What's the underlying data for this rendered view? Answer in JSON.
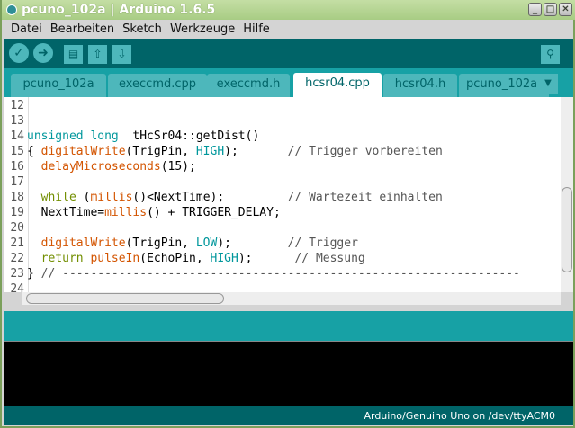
{
  "window": {
    "title": "pcuno_102a | Arduino 1.6.5",
    "buttons": [
      "_",
      "□",
      "✕"
    ]
  },
  "menu": [
    "Datei",
    "Bearbeiten",
    "Sketch",
    "Werkzeuge",
    "Hilfe"
  ],
  "toolbar": {
    "verify": "✓",
    "upload": "➜",
    "new": "▤",
    "open": "⇧",
    "save": "⇩",
    "serial_monitor": "⚲"
  },
  "tabs": [
    {
      "label": "pcuno_102a",
      "active": false
    },
    {
      "label": "execcmd.cpp",
      "active": false
    },
    {
      "label": "execcmd.h",
      "active": false
    },
    {
      "label": "hcsr04.cpp",
      "active": true
    },
    {
      "label": "hcsr04.h",
      "active": false
    },
    {
      "label": "pcuno_102a.h",
      "active": false
    }
  ],
  "tab_menu": "▼",
  "code": [
    {
      "n": "12",
      "seg": []
    },
    {
      "n": "13",
      "seg": []
    },
    {
      "n": "14",
      "seg": [
        [
          "unsigned long",
          "kw"
        ],
        [
          "  tHcSr04::getDist()",
          "pl"
        ]
      ]
    },
    {
      "n": "15",
      "seg": [
        [
          "{ ",
          "pl"
        ],
        [
          "digitalWrite",
          "fn"
        ],
        [
          "(TrigPin, ",
          "pl"
        ],
        [
          "HIGH",
          "kw"
        ],
        [
          ");       ",
          "pl"
        ],
        [
          "// Trigger vorbereiten",
          "cm"
        ]
      ]
    },
    {
      "n": "16",
      "seg": [
        [
          "  ",
          "pl"
        ],
        [
          "delayMicroseconds",
          "fn"
        ],
        [
          "(15);",
          "pl"
        ]
      ]
    },
    {
      "n": "17",
      "seg": []
    },
    {
      "n": "18",
      "seg": [
        [
          "  ",
          "pl"
        ],
        [
          "while",
          "ctl"
        ],
        [
          " (",
          "pl"
        ],
        [
          "millis",
          "fn"
        ],
        [
          "()<NextTime);         ",
          "pl"
        ],
        [
          "// Wartezeit einhalten",
          "cm"
        ]
      ]
    },
    {
      "n": "19",
      "seg": [
        [
          "  NextTime=",
          "pl"
        ],
        [
          "millis",
          "fn"
        ],
        [
          "() + TRIGGER_DELAY;",
          "pl"
        ]
      ]
    },
    {
      "n": "20",
      "seg": []
    },
    {
      "n": "21",
      "seg": [
        [
          "  ",
          "pl"
        ],
        [
          "digitalWrite",
          "fn"
        ],
        [
          "(TrigPin, ",
          "pl"
        ],
        [
          "LOW",
          "kw"
        ],
        [
          ");        ",
          "pl"
        ],
        [
          "// Trigger",
          "cm"
        ]
      ]
    },
    {
      "n": "22",
      "seg": [
        [
          "  ",
          "pl"
        ],
        [
          "return",
          "ctl"
        ],
        [
          " ",
          "pl"
        ],
        [
          "pulseIn",
          "fn"
        ],
        [
          "(EchoPin, ",
          "pl"
        ],
        [
          "HIGH",
          "kw"
        ],
        [
          ");      ",
          "pl"
        ],
        [
          "// Messung",
          "cm"
        ]
      ]
    },
    {
      "n": "23",
      "seg": [
        [
          "} ",
          "pl"
        ],
        [
          "// -----------------------------------------------------------------",
          "cm"
        ]
      ]
    },
    {
      "n": "24",
      "seg": []
    }
  ],
  "status": {
    "board": "Arduino/Genuino Uno on /dev/ttyACM0"
  }
}
